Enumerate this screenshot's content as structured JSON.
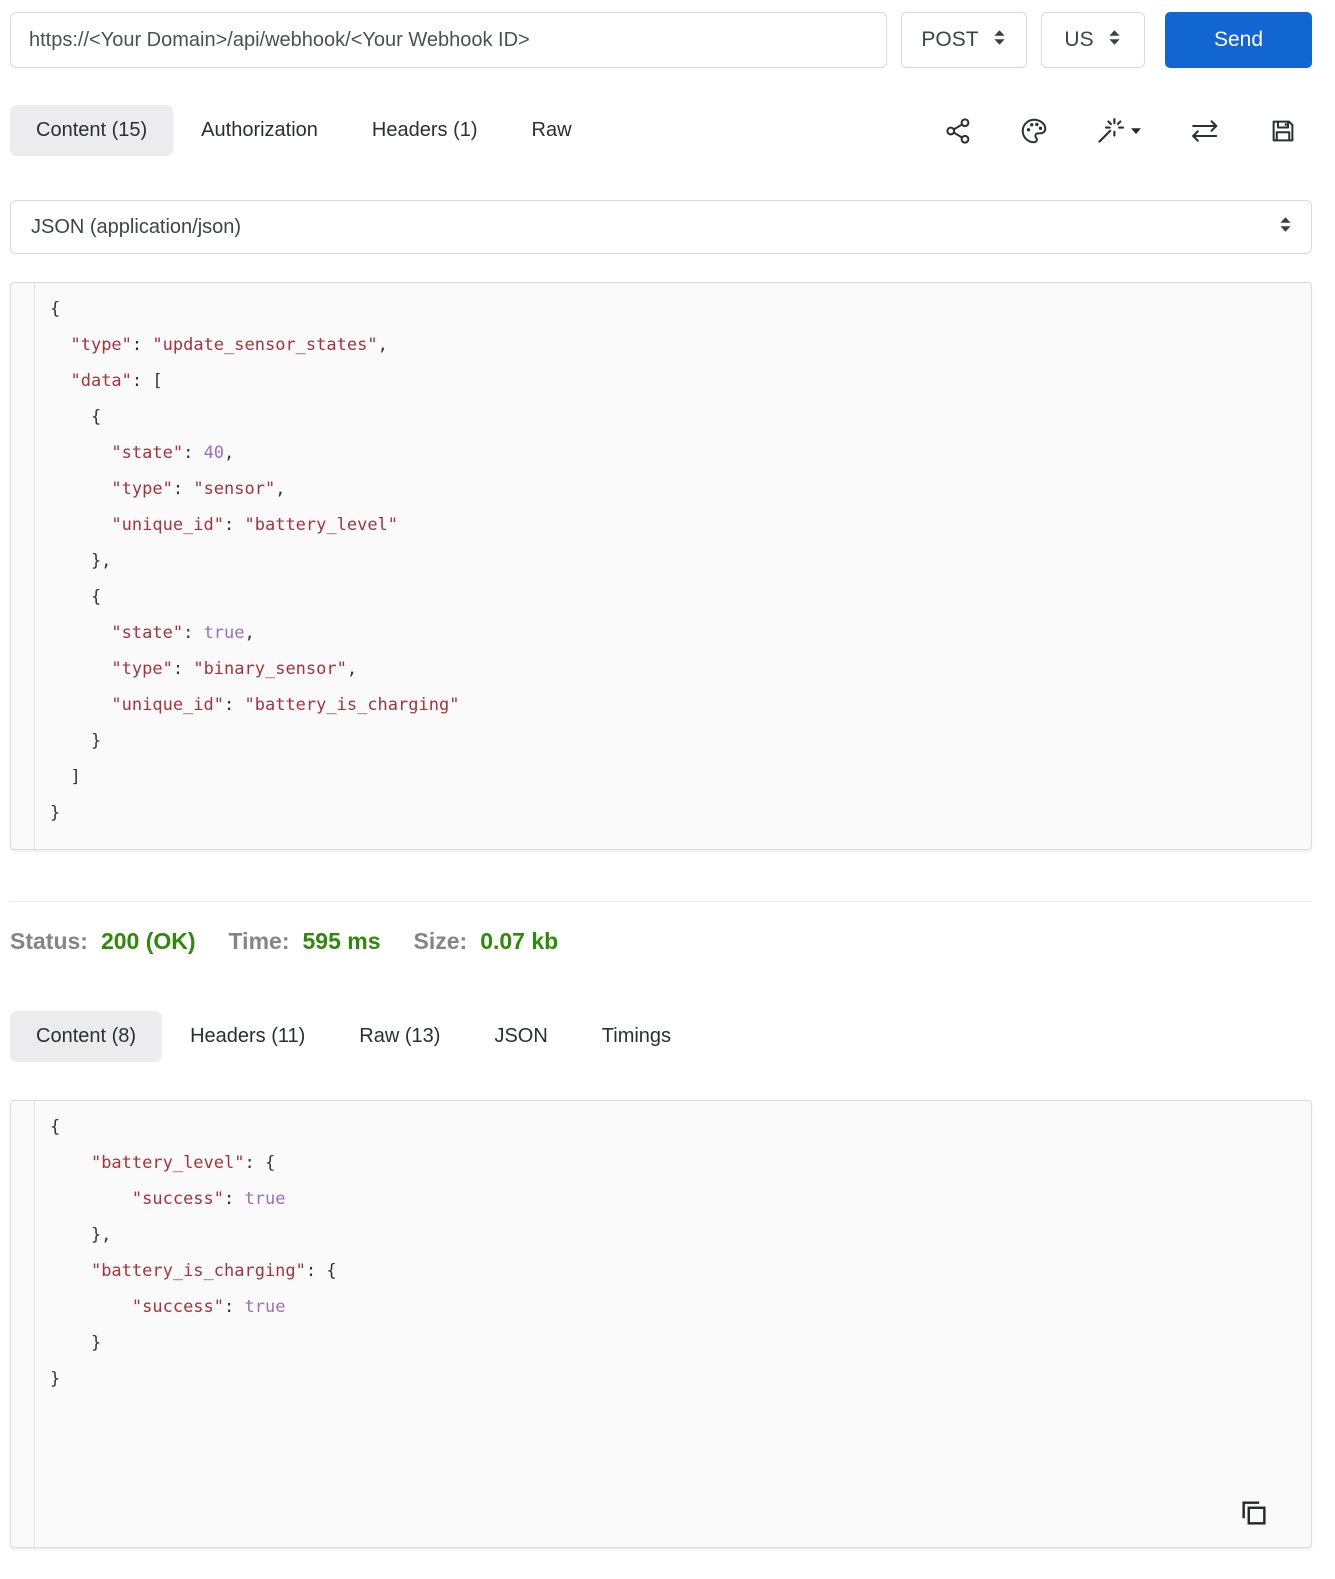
{
  "request_bar": {
    "url": "https://<Your Domain>/api/webhook/<Your Webhook ID>",
    "method": "POST",
    "region": "US",
    "send_label": "Send"
  },
  "request_tabs": [
    {
      "label": "Content (15)",
      "active": true
    },
    {
      "label": "Authorization",
      "active": false
    },
    {
      "label": "Headers (1)",
      "active": false
    },
    {
      "label": "Raw",
      "active": false
    }
  ],
  "toolbar": {
    "icons": [
      "share-icon",
      "palette-icon",
      "magic-wand-icon",
      "swap-arrows-icon",
      "save-icon"
    ]
  },
  "content_type_select": {
    "value": "JSON (application/json)"
  },
  "request_body_lines": [
    [
      [
        "p",
        "{"
      ]
    ],
    [
      [
        "p",
        "  "
      ],
      [
        "s",
        "\"type\""
      ],
      [
        "p",
        ": "
      ],
      [
        "s",
        "\"update_sensor_states\""
      ],
      [
        "p",
        ","
      ]
    ],
    [
      [
        "p",
        "  "
      ],
      [
        "s",
        "\"data\""
      ],
      [
        "p",
        ": ["
      ]
    ],
    [
      [
        "p",
        "    {"
      ]
    ],
    [
      [
        "p",
        "      "
      ],
      [
        "s",
        "\"state\""
      ],
      [
        "p",
        ": "
      ],
      [
        "v",
        "40"
      ],
      [
        "p",
        ","
      ]
    ],
    [
      [
        "p",
        "      "
      ],
      [
        "s",
        "\"type\""
      ],
      [
        "p",
        ": "
      ],
      [
        "s",
        "\"sensor\""
      ],
      [
        "p",
        ","
      ]
    ],
    [
      [
        "p",
        "      "
      ],
      [
        "s",
        "\"unique_id\""
      ],
      [
        "p",
        ": "
      ],
      [
        "s",
        "\"battery_level\""
      ]
    ],
    [
      [
        "p",
        "    },"
      ]
    ],
    [
      [
        "p",
        "    {"
      ]
    ],
    [
      [
        "p",
        "      "
      ],
      [
        "s",
        "\"state\""
      ],
      [
        "p",
        ": "
      ],
      [
        "v",
        "true"
      ],
      [
        "p",
        ","
      ]
    ],
    [
      [
        "p",
        "      "
      ],
      [
        "s",
        "\"type\""
      ],
      [
        "p",
        ": "
      ],
      [
        "s",
        "\"binary_sensor\""
      ],
      [
        "p",
        ","
      ]
    ],
    [
      [
        "p",
        "      "
      ],
      [
        "s",
        "\"unique_id\""
      ],
      [
        "p",
        ": "
      ],
      [
        "s",
        "\"battery_is_charging\""
      ]
    ],
    [
      [
        "p",
        "    }"
      ]
    ],
    [
      [
        "p",
        "  ]"
      ]
    ],
    [
      [
        "p",
        "}"
      ]
    ]
  ],
  "response": {
    "status": {
      "status_label": "Status:",
      "status_value": "200 (OK)",
      "time_label": "Time:",
      "time_value": "595 ms",
      "size_label": "Size:",
      "size_value": "0.07 kb"
    },
    "tabs": [
      {
        "label": "Content (8)",
        "active": true
      },
      {
        "label": "Headers (11)",
        "active": false
      },
      {
        "label": "Raw (13)",
        "active": false
      },
      {
        "label": "JSON",
        "active": false
      },
      {
        "label": "Timings",
        "active": false
      }
    ],
    "body_lines": [
      [
        [
          "p",
          "{"
        ]
      ],
      [
        [
          "p",
          "    "
        ],
        [
          "s",
          "\"battery_level\""
        ],
        [
          "p",
          ": {"
        ]
      ],
      [
        [
          "p",
          "        "
        ],
        [
          "s",
          "\"success\""
        ],
        [
          "p",
          ": "
        ],
        [
          "v",
          "true"
        ]
      ],
      [
        [
          "p",
          "    },"
        ]
      ],
      [
        [
          "p",
          "    "
        ],
        [
          "s",
          "\"battery_is_charging\""
        ],
        [
          "p",
          ": {"
        ]
      ],
      [
        [
          "p",
          "        "
        ],
        [
          "s",
          "\"success\""
        ],
        [
          "p",
          ": "
        ],
        [
          "v",
          "true"
        ]
      ],
      [
        [
          "p",
          "    }"
        ]
      ],
      [
        [
          "p",
          "}"
        ]
      ]
    ]
  },
  "colors": {
    "accent": "#1266d2",
    "code_string": "#a3333d",
    "code_value": "#9b6fc0",
    "code_punct": "#32323a",
    "status_green": "#2f8a0c",
    "label_gray": "#84848e",
    "active_tab_bg": "#ececef",
    "code_bg": "#fafafa",
    "border": "#d9d9de"
  }
}
